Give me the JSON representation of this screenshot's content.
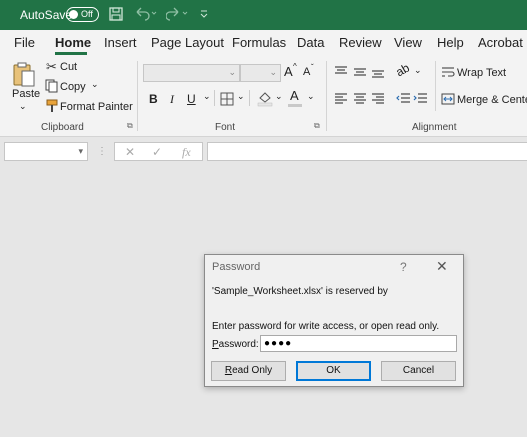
{
  "titlebar": {
    "autosave_label": "AutoSave",
    "autosave_state": "Off"
  },
  "tabs": [
    {
      "label": "File"
    },
    {
      "label": "Home"
    },
    {
      "label": "Insert"
    },
    {
      "label": "Page Layout"
    },
    {
      "label": "Formulas"
    },
    {
      "label": "Data"
    },
    {
      "label": "Review"
    },
    {
      "label": "View"
    },
    {
      "label": "Help"
    },
    {
      "label": "Acrobat"
    }
  ],
  "ribbon": {
    "clipboard": {
      "paste": "Paste",
      "cut": "Cut",
      "copy": "Copy",
      "format_painter": "Format Painter",
      "label": "Clipboard"
    },
    "font": {
      "label": "Font",
      "bold": "B",
      "italic": "I",
      "underline": "U",
      "grow": "A",
      "shrink": "A"
    },
    "alignment": {
      "label": "Alignment",
      "wrap_text": "Wrap Text",
      "merge_center": "Merge & Center"
    }
  },
  "formula_bar": {
    "fx": "fx"
  },
  "dialog": {
    "title": "Password",
    "help": "?",
    "close": "✕",
    "message1": "'Sample_Worksheet.xlsx' is reserved by",
    "message2": "Enter password for write access, or open read only.",
    "password_label_prefix": "",
    "password_label_underlined": "P",
    "password_label_rest": "assword:",
    "password_value": "●●●●",
    "read_only_underlined": "R",
    "read_only_rest": "ead Only",
    "ok": "OK",
    "cancel": "Cancel"
  },
  "colors": {
    "accent": "#217346",
    "default_button_border": "#0078d7"
  }
}
